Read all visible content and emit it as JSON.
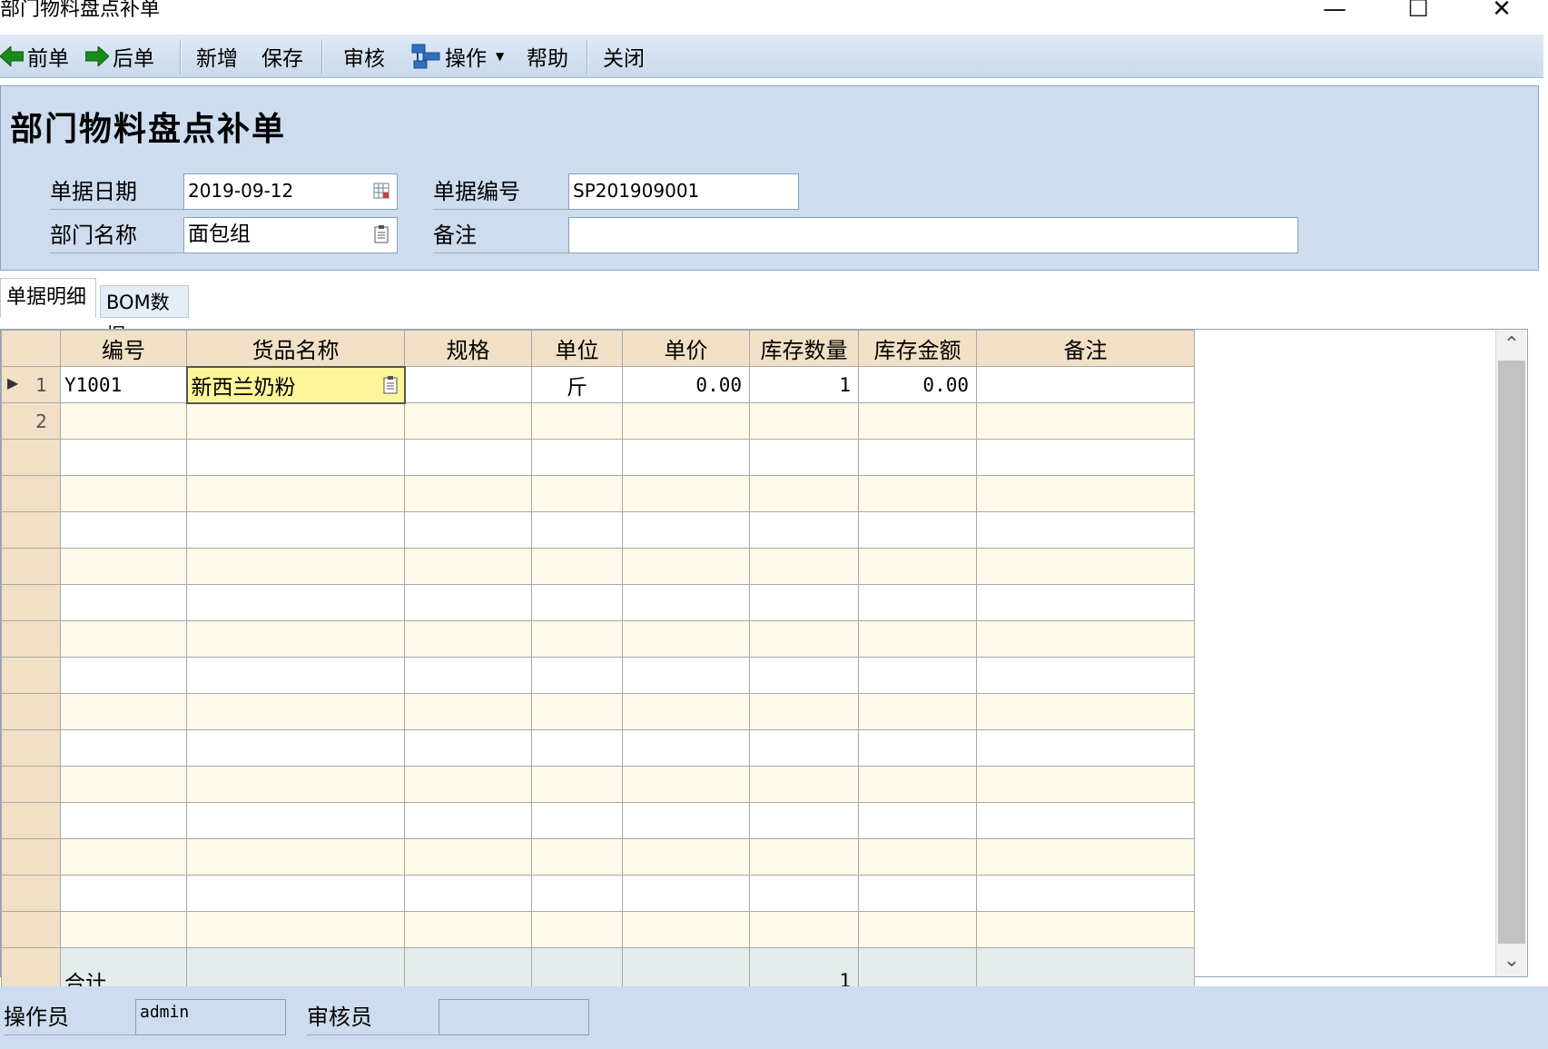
{
  "window": {
    "title": "部门物料盘点补单",
    "minimize": "—",
    "maximize": "☐",
    "close": "✕"
  },
  "toolbar": {
    "prev": "前单",
    "next": "后单",
    "new": "新增",
    "save": "保存",
    "audit": "审核",
    "operate": "操作",
    "help": "帮助",
    "close": "关闭"
  },
  "form": {
    "heading": "部门物料盘点补单",
    "date_label": "单据日期",
    "date_value": "2019-09-12",
    "docno_label": "单据编号",
    "docno_value": "SP201909001",
    "dept_label": "部门名称",
    "dept_value": "面包组",
    "remark_label": "备注",
    "remark_value": ""
  },
  "tabs": {
    "detail": "单据明细",
    "bom": "BOM数据"
  },
  "grid": {
    "columns": [
      "编号",
      "货品名称",
      "规格",
      "单位",
      "单价",
      "库存数量",
      "库存金额",
      "备注"
    ],
    "rows": [
      {
        "rownum": "1",
        "code": "Y1001",
        "name": "新西兰奶粉",
        "spec": "",
        "unit": "斤",
        "price": "0.00",
        "qty": "1",
        "amount": "0.00",
        "note": ""
      },
      {
        "rownum": "2",
        "code": "",
        "name": "",
        "spec": "",
        "unit": "",
        "price": "",
        "qty": "",
        "amount": "",
        "note": ""
      }
    ],
    "total_label": "合计",
    "total_qty": "1"
  },
  "footer": {
    "operator_label": "操作员",
    "operator_value": "admin",
    "auditor_label": "审核员",
    "auditor_value": ""
  },
  "colors": {
    "panel": "#cddcee",
    "header": "#f1e0c6",
    "alt_row": "#fff9ea",
    "editing_cell": "#fdf59a"
  }
}
